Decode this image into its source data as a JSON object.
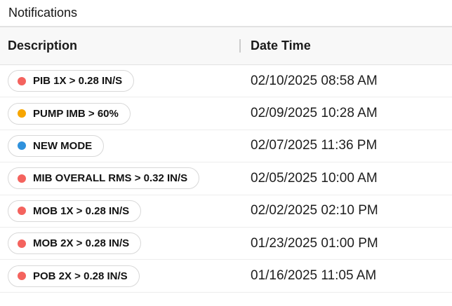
{
  "title": "Notifications",
  "table": {
    "columns": [
      {
        "label": "Description"
      },
      {
        "label": "Date Time"
      }
    ],
    "severity_colors": {
      "red": "#f4635e",
      "orange": "#f7a600",
      "blue": "#2f91dc"
    },
    "rows": [
      {
        "severity": "red",
        "description": "PIB 1X > 0.28 IN/S",
        "datetime": "02/10/2025 08:58 AM"
      },
      {
        "severity": "orange",
        "description": "PUMP IMB > 60%",
        "datetime": "02/09/2025 10:28 AM"
      },
      {
        "severity": "blue",
        "description": "NEW MODE",
        "datetime": "02/07/2025 11:36 PM"
      },
      {
        "severity": "red",
        "description": "MIB OVERALL RMS > 0.32 IN/S",
        "datetime": "02/05/2025 10:00 AM"
      },
      {
        "severity": "red",
        "description": "MOB 1X > 0.28 IN/S",
        "datetime": "02/02/2025 02:10 PM"
      },
      {
        "severity": "red",
        "description": "MOB 2X > 0.28 IN/S",
        "datetime": "01/23/2025 01:00 PM"
      },
      {
        "severity": "red",
        "description": "POB 2X > 0.28 IN/S",
        "datetime": "01/16/2025 11:05 AM"
      }
    ]
  }
}
